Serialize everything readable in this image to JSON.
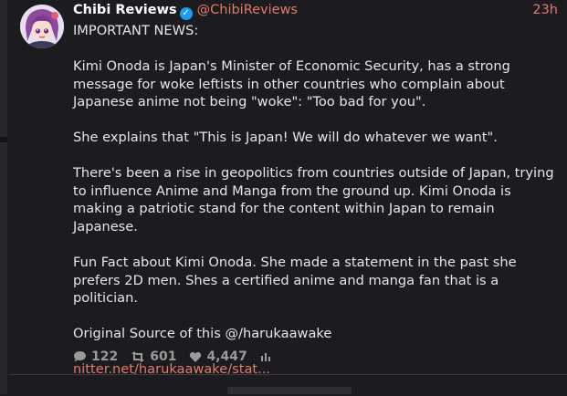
{
  "tweet": {
    "display_name": "Chibi Reviews",
    "handle": "@ChibiReviews",
    "time": "23h",
    "paragraphs": [
      "IMPORTANT NEWS:",
      "Kimi Onoda is Japan's Minister of Economic Security, has a strong message for woke leftists in other countries who complain about Japanese anime not being \"woke\": \"Too bad for you\".",
      "She explains that \"This is Japan! We will do whatever we want\".",
      "There's been a rise in geopolitics from countries outside of Japan, trying to influence Anime and Manga from the ground up.  Kimi Onoda is making a patriotic stand for the content within Japan to remain Japanese.",
      "Fun Fact about Kimi Onoda. She made a statement in the past she prefers 2D men. Shes a certified anime and manga fan that is a politician.",
      "Original Source of this @/harukaawake"
    ],
    "link_text": "nitter.net/harukaawake/stat...",
    "stats": {
      "replies": "122",
      "retweets": "601",
      "likes": "4,447"
    },
    "icons": {
      "verified": "verified-badge-icon",
      "reply": "comment-icon",
      "retweet": "retweet-icon",
      "like": "heart-icon",
      "views": "bar-chart-icon"
    },
    "colors": {
      "accent": "#e07a6a",
      "verified": "#1d9bf0",
      "background": "#1c1c20"
    }
  }
}
